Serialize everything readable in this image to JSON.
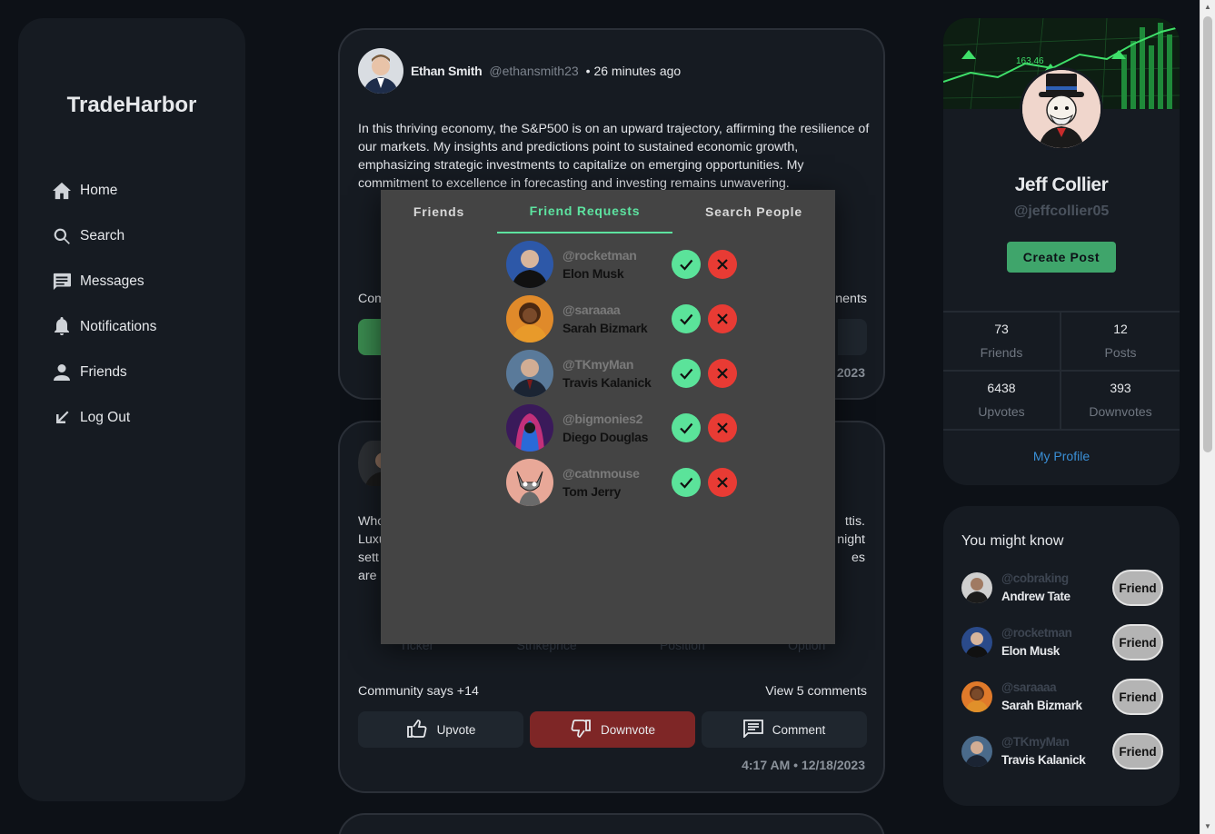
{
  "brand": "TradeHarbor",
  "nav": [
    {
      "label": "Home",
      "icon": "home-icon"
    },
    {
      "label": "Search",
      "icon": "search-icon"
    },
    {
      "label": "Messages",
      "icon": "messages-icon"
    },
    {
      "label": "Notifications",
      "icon": "bell-icon"
    },
    {
      "label": "Friends",
      "icon": "person-icon"
    },
    {
      "label": "Log Out",
      "icon": "logout-arrow-icon"
    }
  ],
  "posts": [
    {
      "author": "Ethan Smith",
      "handle": "@ethansmith23",
      "time": "• 26 minutes ago",
      "body": "In this thriving economy, the S&P500 is on an upward trajectory, affirming the resilience of our markets. My insights and predictions point to sustained economic growth, emphasizing strategic investments to capitalize on emerging opportunities. My commitment to excellence in forecasting and investing remains unwavering.",
      "community_partial": "Com",
      "comments_partial": "nents",
      "date_partial": "2023"
    },
    {
      "body_partial": [
        "Who",
        "Luxu",
        "sett",
        "are i"
      ],
      "body_right_partial": [
        "ttis.",
        "night",
        "es"
      ],
      "trade_columns": [
        "Ticker",
        "Strikeprice",
        "Position",
        "Option"
      ],
      "community": "Community says +14",
      "comments": "View 5 comments",
      "upvote": "Upvote",
      "downvote": "Downvote",
      "comment": "Comment",
      "timestamp": "4:17 AM • 12/18/2023"
    }
  ],
  "profile": {
    "name": "Jeff Collier",
    "handle": "@jeffcollier05",
    "create_post": "Create Post",
    "banner_value": "163.46",
    "stats": [
      {
        "value": "73",
        "label": "Friends"
      },
      {
        "value": "12",
        "label": "Posts"
      },
      {
        "value": "6438",
        "label": "Upvotes"
      },
      {
        "value": "393",
        "label": "Downvotes"
      }
    ],
    "my_profile": "My Profile"
  },
  "you_might_know": {
    "title": "You might know",
    "button": "Friend",
    "people": [
      {
        "handle": "@cobraking",
        "name": "Andrew Tate"
      },
      {
        "handle": "@rocketman",
        "name": "Elon Musk"
      },
      {
        "handle": "@saraaaa",
        "name": "Sarah Bizmark"
      },
      {
        "handle": "@TKmyMan",
        "name": "Travis Kalanick"
      }
    ]
  },
  "modal": {
    "tabs": [
      "Friends",
      "Friend Requests",
      "Search People"
    ],
    "active_tab": "Friend Requests",
    "requests": [
      {
        "handle": "@rocketman",
        "name": "Elon Musk"
      },
      {
        "handle": "@saraaaa",
        "name": "Sarah Bizmark"
      },
      {
        "handle": "@TKmyMan",
        "name": "Travis Kalanick"
      },
      {
        "handle": "@bigmonies2",
        "name": "Diego Douglas"
      },
      {
        "handle": "@catnmouse",
        "name": "Tom Jerry"
      }
    ]
  },
  "colors": {
    "accent_green": "#5de3a0",
    "downvote_red": "#7e2626",
    "link_blue": "#3a8fd6"
  }
}
